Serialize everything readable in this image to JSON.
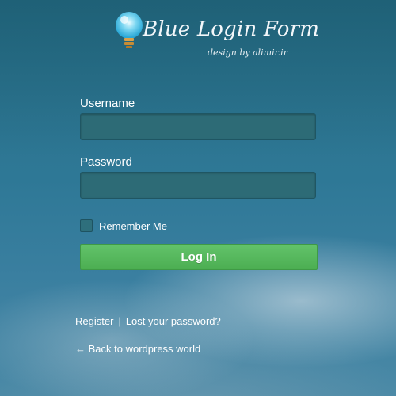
{
  "logo": {
    "title": "Blue Login Form",
    "subtitle": "design by alimir.ir",
    "icon": "lightbulb-icon"
  },
  "form": {
    "username": {
      "label": "Username",
      "value": "",
      "placeholder": ""
    },
    "password": {
      "label": "Password",
      "value": "",
      "placeholder": ""
    },
    "remember": {
      "label": "Remember Me",
      "checked": false
    },
    "submit_label": "Log In"
  },
  "links": {
    "register": "Register",
    "separator": "|",
    "lost_password": "Lost your password?",
    "back": "← Back to wordpress world"
  },
  "colors": {
    "background": "#2e7896",
    "field_bg": "#2d6b76",
    "button": "#55b55c",
    "text": "#ffffff"
  }
}
